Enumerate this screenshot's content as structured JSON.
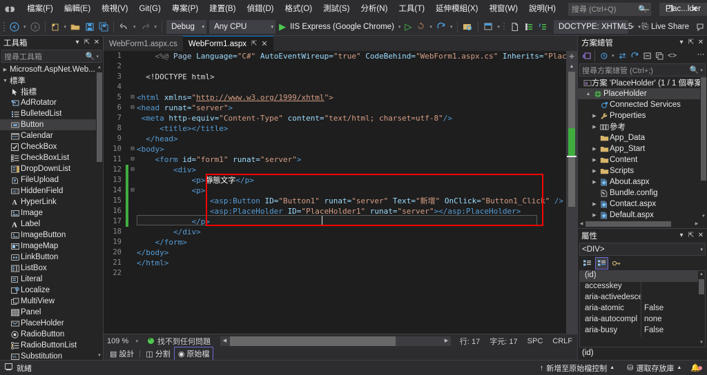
{
  "titlebar": {
    "menus": [
      "檔案(F)",
      "編輯(E)",
      "檢視(V)",
      "Git(G)",
      "專案(P)",
      "建置(B)",
      "偵錯(D)",
      "格式(O)",
      "測試(S)",
      "分析(N)",
      "工具(T)",
      "延伸模組(X)",
      "視窗(W)",
      "說明(H)"
    ],
    "search_placeholder": "搜尋 (Ctrl+Q)",
    "solution_label": "Plac...lder",
    "minimize": "—",
    "maximize": "❐",
    "close": "✕"
  },
  "toolbar": {
    "configuration": "Debug",
    "platform": "Any CPU",
    "run_target": "IIS Express (Google Chrome)",
    "doctype": "DOCTYPE: XHTML5",
    "live_share": "Live Share"
  },
  "toolbox": {
    "title": "工具箱",
    "search_placeholder": "搜尋工具箱",
    "group_aspnet": "Microsoft.AspNet.Web...",
    "group_standard": "標準",
    "items": [
      {
        "label": "指標",
        "icon": "pointer-icon"
      },
      {
        "label": "AdRotator",
        "icon": "adrotator-icon"
      },
      {
        "label": "BulletedList",
        "icon": "bulletedlist-icon"
      },
      {
        "label": "Button",
        "icon": "button-icon"
      },
      {
        "label": "Calendar",
        "icon": "calendar-icon"
      },
      {
        "label": "CheckBox",
        "icon": "checkbox-icon"
      },
      {
        "label": "CheckBoxList",
        "icon": "checkboxlist-icon"
      },
      {
        "label": "DropDownList",
        "icon": "dropdownlist-icon"
      },
      {
        "label": "FileUpload",
        "icon": "fileupload-icon"
      },
      {
        "label": "HiddenField",
        "icon": "hiddenfield-icon"
      },
      {
        "label": "HyperLink",
        "icon": "hyperlink-icon"
      },
      {
        "label": "Image",
        "icon": "image-icon"
      },
      {
        "label": "Label",
        "icon": "label-icon"
      },
      {
        "label": "ImageButton",
        "icon": "imagebutton-icon"
      },
      {
        "label": "ImageMap",
        "icon": "imagemap-icon"
      },
      {
        "label": "LinkButton",
        "icon": "linkbutton-icon"
      },
      {
        "label": "ListBox",
        "icon": "listbox-icon"
      },
      {
        "label": "Literal",
        "icon": "literal-icon"
      },
      {
        "label": "Localize",
        "icon": "localize-icon"
      },
      {
        "label": "MultiView",
        "icon": "multiview-icon"
      },
      {
        "label": "Panel",
        "icon": "panel-icon"
      },
      {
        "label": "PlaceHolder",
        "icon": "placeholder-icon"
      },
      {
        "label": "RadioButton",
        "icon": "radiobutton-icon"
      },
      {
        "label": "RadioButtonList",
        "icon": "radiobuttonlist-icon"
      },
      {
        "label": "Substitution",
        "icon": "substitution-icon"
      }
    ],
    "selected_index": 3
  },
  "tabs": [
    {
      "label": "WebForm1.aspx.cs",
      "active": false
    },
    {
      "label": "WebForm1.aspx",
      "active": true
    }
  ],
  "editor": {
    "lines": [
      {
        "n": 1,
        "changed": false,
        "fold": "",
        "parts": [
          {
            "t": "    ",
            "c": "k-plain"
          },
          {
            "t": "<%@ ",
            "c": "k-punct"
          },
          {
            "t": "Page",
            "c": "k-dir"
          },
          {
            "t": " Language=",
            "c": "k-attr"
          },
          {
            "t": "\"C#\"",
            "c": "k-str"
          },
          {
            "t": " AutoEventWireup=",
            "c": "k-attr"
          },
          {
            "t": "\"true\"",
            "c": "k-str"
          },
          {
            "t": " CodeBehind=",
            "c": "k-attr"
          },
          {
            "t": "\"WebForm1.aspx.cs\"",
            "c": "k-str"
          },
          {
            "t": " Inherits=",
            "c": "k-attr"
          },
          {
            "t": "\"PlaceHolder.WebFo",
            "c": "k-str"
          }
        ]
      },
      {
        "n": 2,
        "changed": false,
        "fold": "",
        "parts": []
      },
      {
        "n": 3,
        "changed": false,
        "fold": "",
        "parts": [
          {
            "t": "  ",
            "c": "k-plain"
          },
          {
            "t": "<!DOCTYPE html>",
            "c": "k-plain"
          }
        ]
      },
      {
        "n": 4,
        "changed": false,
        "fold": "",
        "parts": []
      },
      {
        "n": 5,
        "changed": false,
        "fold": "−",
        "parts": [
          {
            "t": "<html ",
            "c": "k-tag"
          },
          {
            "t": "xmlns=",
            "c": "k-attr"
          },
          {
            "t": "\"",
            "c": "k-str"
          },
          {
            "t": "http://www.w3.org/1999/xhtml",
            "c": "k-link"
          },
          {
            "t": "\">",
            "c": "k-str"
          }
        ]
      },
      {
        "n": 6,
        "changed": false,
        "fold": "−",
        "parts": [
          {
            "t": "<head ",
            "c": "k-tag"
          },
          {
            "t": "runat=",
            "c": "k-attr"
          },
          {
            "t": "\"server\"",
            "c": "k-str"
          },
          {
            "t": ">",
            "c": "k-tag"
          }
        ]
      },
      {
        "n": 7,
        "changed": false,
        "fold": "",
        "parts": [
          {
            "t": " ",
            "c": "k-plain"
          },
          {
            "t": "<meta ",
            "c": "k-tag"
          },
          {
            "t": "http-equiv=",
            "c": "k-attr"
          },
          {
            "t": "\"Content-Type\"",
            "c": "k-str"
          },
          {
            "t": " content=",
            "c": "k-attr"
          },
          {
            "t": "\"text/html; charset=utf-8\"",
            "c": "k-str"
          },
          {
            "t": "/>",
            "c": "k-tag"
          }
        ]
      },
      {
        "n": 8,
        "changed": false,
        "fold": "",
        "parts": [
          {
            "t": "     ",
            "c": "k-plain"
          },
          {
            "t": "<title></title>",
            "c": "k-tag"
          }
        ]
      },
      {
        "n": 9,
        "changed": false,
        "fold": "",
        "parts": [
          {
            "t": "  ",
            "c": "k-plain"
          },
          {
            "t": "</head>",
            "c": "k-tag"
          }
        ]
      },
      {
        "n": 10,
        "changed": false,
        "fold": "−",
        "parts": [
          {
            "t": "<body>",
            "c": "k-tag"
          }
        ]
      },
      {
        "n": 11,
        "changed": false,
        "fold": "−",
        "parts": [
          {
            "t": "    ",
            "c": "k-plain"
          },
          {
            "t": "<form ",
            "c": "k-tag"
          },
          {
            "t": "id=",
            "c": "k-attr"
          },
          {
            "t": "\"form1\"",
            "c": "k-str"
          },
          {
            "t": " runat=",
            "c": "k-attr"
          },
          {
            "t": "\"server\"",
            "c": "k-str"
          },
          {
            "t": ">",
            "c": "k-tag"
          }
        ]
      },
      {
        "n": 12,
        "changed": true,
        "fold": "−",
        "parts": [
          {
            "t": "        ",
            "c": "k-plain"
          },
          {
            "t": "<div>",
            "c": "k-tag"
          }
        ]
      },
      {
        "n": 13,
        "changed": true,
        "fold": "",
        "parts": [
          {
            "t": "            ",
            "c": "k-plain"
          },
          {
            "t": "<p>",
            "c": "k-tag"
          },
          {
            "t": "靜態文字",
            "c": "k-cn"
          },
          {
            "t": "</p>",
            "c": "k-tag"
          }
        ]
      },
      {
        "n": 14,
        "changed": true,
        "fold": "−",
        "parts": [
          {
            "t": "            ",
            "c": "k-plain"
          },
          {
            "t": "<p>",
            "c": "k-tag"
          }
        ]
      },
      {
        "n": 15,
        "changed": true,
        "fold": "",
        "parts": [
          {
            "t": "                ",
            "c": "k-plain"
          },
          {
            "t": "<asp:Button ",
            "c": "k-tag"
          },
          {
            "t": "ID=",
            "c": "k-attr"
          },
          {
            "t": "\"Button1\"",
            "c": "k-str"
          },
          {
            "t": " runat=",
            "c": "k-attr"
          },
          {
            "t": "\"server\"",
            "c": "k-str"
          },
          {
            "t": " Text=",
            "c": "k-attr"
          },
          {
            "t": "\"新增\"",
            "c": "k-str"
          },
          {
            "t": " OnClick=",
            "c": "k-attr"
          },
          {
            "t": "\"Button1_Click\"",
            "c": "k-str"
          },
          {
            "t": " />",
            "c": "k-tag"
          }
        ]
      },
      {
        "n": 16,
        "changed": true,
        "fold": "",
        "parts": [
          {
            "t": "                ",
            "c": "k-plain"
          },
          {
            "t": "<asp:PlaceHolder ",
            "c": "k-tag"
          },
          {
            "t": "ID=",
            "c": "k-attr"
          },
          {
            "t": "\"PlaceHolder1\"",
            "c": "k-str"
          },
          {
            "t": " runat=",
            "c": "k-attr"
          },
          {
            "t": "\"server\"",
            "c": "k-str"
          },
          {
            "t": "></asp:PlaceHolder>",
            "c": "k-tag"
          }
        ]
      },
      {
        "n": 17,
        "changed": true,
        "fold": "",
        "parts": [
          {
            "t": "            ",
            "c": "k-plain"
          },
          {
            "t": "</p>",
            "c": "k-tag"
          }
        ]
      },
      {
        "n": 18,
        "changed": false,
        "fold": "",
        "parts": [
          {
            "t": "        ",
            "c": "k-plain"
          },
          {
            "t": "</div>",
            "c": "k-tag"
          }
        ]
      },
      {
        "n": 19,
        "changed": false,
        "fold": "",
        "parts": [
          {
            "t": "    ",
            "c": "k-plain"
          },
          {
            "t": "</form>",
            "c": "k-tag"
          }
        ]
      },
      {
        "n": 20,
        "changed": false,
        "fold": "",
        "parts": [
          {
            "t": "</body>",
            "c": "k-tag"
          }
        ]
      },
      {
        "n": 21,
        "changed": false,
        "fold": "",
        "parts": [
          {
            "t": "</html>",
            "c": "k-tag"
          }
        ]
      },
      {
        "n": 22,
        "changed": false,
        "fold": "",
        "parts": []
      }
    ],
    "highlight_color": "#ff0000"
  },
  "editor_status": {
    "zoom": "109 %",
    "problems": "找不到任何問題",
    "line": "行: 17",
    "column": "字元: 17",
    "spaces": "SPC",
    "eol": "CRLF"
  },
  "view_tabs": [
    {
      "label": "設計",
      "active": false
    },
    {
      "label": "分割",
      "active": false
    },
    {
      "label": "原始檔",
      "active": true
    }
  ],
  "solution_explorer": {
    "title": "方案總管",
    "search_placeholder": "搜尋方案總管 (Ctrl+;)",
    "root": "方案 'PlaceHolder' (1 / 1 個專案",
    "nodes": [
      {
        "label": "PlaceHolder",
        "indent": 1,
        "twisty": "▲",
        "icon": "project-icon",
        "selected": true
      },
      {
        "label": "Connected Services",
        "indent": 2,
        "twisty": "",
        "icon": "connected-services-icon",
        "selected": false
      },
      {
        "label": "Properties",
        "indent": 2,
        "twisty": "▶",
        "icon": "wrench-icon",
        "selected": false
      },
      {
        "label": "參考",
        "indent": 2,
        "twisty": "▶",
        "icon": "references-icon",
        "selected": false
      },
      {
        "label": "App_Data",
        "indent": 2,
        "twisty": "",
        "icon": "folder-icon",
        "selected": false
      },
      {
        "label": "App_Start",
        "indent": 2,
        "twisty": "▶",
        "icon": "folder-icon",
        "selected": false
      },
      {
        "label": "Content",
        "indent": 2,
        "twisty": "▶",
        "icon": "folder-icon",
        "selected": false
      },
      {
        "label": "Scripts",
        "indent": 2,
        "twisty": "▶",
        "icon": "folder-icon",
        "selected": false
      },
      {
        "label": "About.aspx",
        "indent": 2,
        "twisty": "▶",
        "icon": "aspx-icon",
        "selected": false
      },
      {
        "label": "Bundle.config",
        "indent": 2,
        "twisty": "",
        "icon": "config-icon",
        "selected": false
      },
      {
        "label": "Contact.aspx",
        "indent": 2,
        "twisty": "▶",
        "icon": "aspx-icon",
        "selected": false
      },
      {
        "label": "Default.aspx",
        "indent": 2,
        "twisty": "▶",
        "icon": "aspx-icon",
        "selected": false
      }
    ]
  },
  "properties": {
    "title": "屬性",
    "selected_object": "<DIV>",
    "rows": [
      {
        "name": "(id)",
        "value": "",
        "selected": true
      },
      {
        "name": "accesskey",
        "value": "",
        "selected": false
      },
      {
        "name": "aria-activedesce",
        "value": "",
        "selected": false
      },
      {
        "name": "aria-atomic",
        "value": "False",
        "selected": false
      },
      {
        "name": "aria-autocompl",
        "value": "none",
        "selected": false
      },
      {
        "name": "aria-busy",
        "value": "False",
        "selected": false
      }
    ],
    "description": "(id)"
  },
  "statusbar": {
    "state": "就緒",
    "source_control": "新增至原始檔控制",
    "repo": "選取存放庫"
  }
}
